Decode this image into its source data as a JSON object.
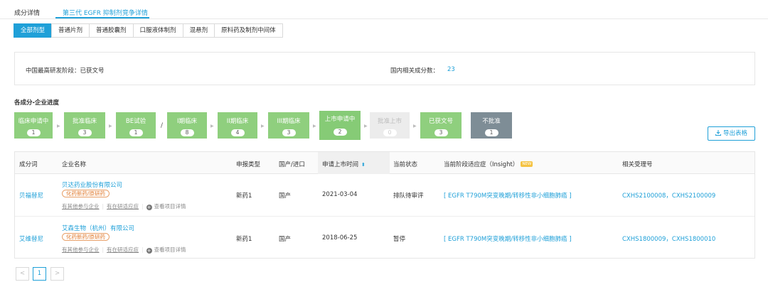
{
  "top_tabs": [
    {
      "label": "成分详情",
      "active": false
    },
    {
      "label": "第三代 EGFR 抑制剂竞争详情",
      "active": true
    }
  ],
  "dose_tabs": [
    {
      "label": "全部剂型",
      "active": true
    },
    {
      "label": "普通片剂",
      "active": false
    },
    {
      "label": "普通胶囊剂",
      "active": false
    },
    {
      "label": "口服液体制剂",
      "active": false
    },
    {
      "label": "混悬剂",
      "active": false
    },
    {
      "label": "原料药及制剂中间体",
      "active": false
    }
  ],
  "summary": {
    "highest_stage_label": "中国最高研发阶段：已获文号",
    "count_label": "国内相关成分数：",
    "count_value": "23"
  },
  "section_title": "各成分-企业进度",
  "stages": [
    {
      "label": "临床申请中",
      "count": "1",
      "state": "normal"
    },
    {
      "label": "批准临床",
      "count": "3",
      "state": "normal"
    },
    {
      "label": "BE试验",
      "count": "1",
      "state": "normal"
    },
    {
      "label": "I期临床",
      "count": "8",
      "state": "normal"
    },
    {
      "label": "II期临床",
      "count": "4",
      "state": "normal"
    },
    {
      "label": "III期临床",
      "count": "3",
      "state": "normal"
    },
    {
      "label": "上市申请中",
      "count": "2",
      "state": "current"
    },
    {
      "label": "批准上市",
      "count": "0",
      "state": "disabled"
    },
    {
      "label": "已获文号",
      "count": "3",
      "state": "normal"
    },
    {
      "label": "不批准",
      "count": "1",
      "state": "rejected"
    }
  ],
  "stage_separator": "/",
  "export_label": "导出表格",
  "table": {
    "headers": {
      "ingredient": "成分词",
      "company": "企业名称",
      "apply_type": "申报类型",
      "origin": "国产/进口",
      "apply_time": "申请上市时间",
      "status": "当前状态",
      "indication": "当前阶段适应症（Insight）",
      "new_badge": "NEW",
      "receipt": "相关受理号"
    },
    "rows": [
      {
        "ingredient": "贝福替尼",
        "company": "贝达药业股份有限公司",
        "tag": "化药新药/原研药",
        "link_participate": "有其他参与企业",
        "link_indication": "有在研适应症",
        "link_detail": "查看项目详情",
        "apply_type": "新药1",
        "origin": "国产",
        "apply_time": "2021-03-04",
        "status": "排队待审评",
        "indication": "[ EGFR T790M突变晚期/转移性非小细胞肺癌 ]",
        "receipt": "CXHS2100008，CXHS2100009"
      },
      {
        "ingredient": "艾维替尼",
        "company": "艾森生物（杭州）有限公司",
        "tag": "化药新药/原研药",
        "link_participate": "有其他参与企业",
        "link_indication": "有在研适应症",
        "link_detail": "查看项目详情",
        "apply_type": "新药1",
        "origin": "国产",
        "apply_time": "2018-06-25",
        "status": "暂停",
        "indication": "[ EGFR T790M突变晚期/转移性非小细胞肺癌 ]",
        "receipt": "CXHS1800009，CXHS1800010"
      }
    ]
  },
  "pager": {
    "prev": "<",
    "current": "1",
    "next": ">"
  },
  "colors": {
    "accent": "#1fa0d8",
    "stage_green": "#8fcf7e",
    "stage_gray": "#7e8d96",
    "tag_orange": "#e07a2e"
  }
}
